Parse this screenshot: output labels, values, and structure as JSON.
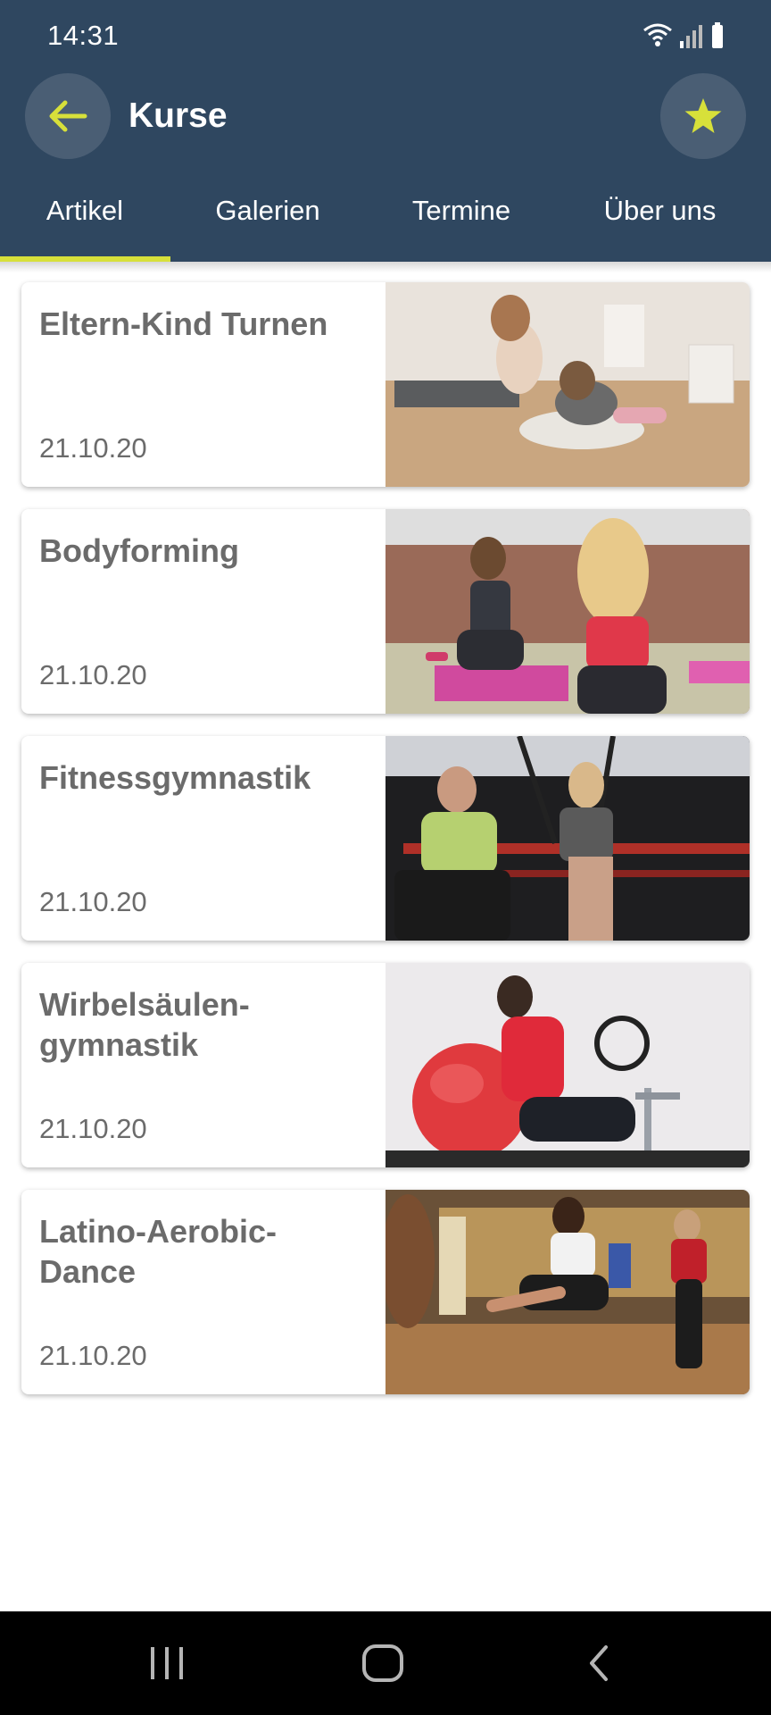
{
  "status_bar": {
    "time": "14:31"
  },
  "header": {
    "title": "Kurse"
  },
  "tabs": [
    {
      "label": "Artikel",
      "active": true
    },
    {
      "label": "Galerien"
    },
    {
      "label": "Termine"
    },
    {
      "label": "Über uns"
    }
  ],
  "colors": {
    "primary": "#2f4760",
    "accent": "#d7e03a",
    "text": "#6b6b6b"
  },
  "articles": [
    {
      "title": "Eltern-Kind Turnen",
      "date": "21.10.20"
    },
    {
      "title": "Bodyforming",
      "date": "21.10.20"
    },
    {
      "title": "Fitnessgymnastik",
      "date": "21.10.20"
    },
    {
      "title": "Wirbelsäulen-gymnastik",
      "date": "21.10.20"
    },
    {
      "title": "Latino-Aerobic-Dance",
      "date": "21.10.20"
    }
  ]
}
